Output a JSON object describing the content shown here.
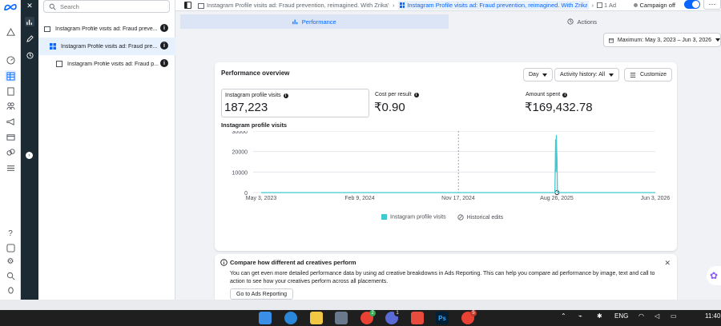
{
  "search": {
    "placeholder": "Search"
  },
  "tree": {
    "items": [
      {
        "label": "Instagram Profile visits ad: Fraud preve...",
        "type": "campaign"
      },
      {
        "label": "Instagram Profile visits ad: Fraud pre...",
        "type": "adset",
        "selected": true
      },
      {
        "label": "Instagram Profile visits ad: Fraud p...",
        "type": "ad"
      }
    ]
  },
  "breadcrumb": {
    "campaign": "Instagram Profile visits ad: Fraud prevention, reimagined. With Zrika's",
    "adset": "Instagram Profile visits ad: Fraud prevention, reimagined. With Zrika's",
    "ad": "1 Ad"
  },
  "status": {
    "campaign_state": "Campaign off"
  },
  "tabs": [
    {
      "label": "Performance",
      "active": true
    },
    {
      "label": "Actions",
      "active": false
    }
  ],
  "date_range": "Maximum: May 3, 2023 – Jun 3, 2026",
  "performance": {
    "title": "Performance overview",
    "controls": {
      "granularity": "Day",
      "activity": "Activity history: All",
      "customize": "Customize"
    },
    "metrics": [
      {
        "label": "Instagram profile visits",
        "value": "187,223"
      },
      {
        "label": "Cost per result",
        "value": "₹0.90"
      },
      {
        "label": "Amount spent",
        "value": "₹169,432.78"
      }
    ],
    "chart_title": "Instagram profile visits"
  },
  "chart_data": {
    "type": "line",
    "title": "Instagram profile visits",
    "x_ticks": [
      "May 3, 2023",
      "Feb 9, 2024",
      "Nov 17, 2024",
      "Aug 26, 2025",
      "Jun 3, 2026"
    ],
    "y_ticks": [
      "0",
      "10000",
      "20000",
      "30000"
    ],
    "ylim": [
      0,
      30000
    ],
    "xlim": [
      "2023-05-03",
      "2026-06-03"
    ],
    "series": [
      {
        "name": "Instagram profile visits",
        "color": "#3ecbcf",
        "points": [
          {
            "x": "2023-05-03",
            "y": 0
          },
          {
            "x": "2025-08-20",
            "y": 0
          },
          {
            "x": "2025-08-22",
            "y": 26000
          },
          {
            "x": "2025-08-23",
            "y": 10000
          },
          {
            "x": "2025-08-24",
            "y": 28000
          },
          {
            "x": "2025-08-25",
            "y": 20000
          },
          {
            "x": "2025-08-26",
            "y": 16000
          },
          {
            "x": "2025-08-27",
            "y": 0
          },
          {
            "x": "2026-06-03",
            "y": 0
          }
        ]
      }
    ],
    "markers": [
      {
        "x": "2024-11-17",
        "style": "dashed"
      },
      {
        "x": "2025-08-26",
        "label": "historical-edit"
      }
    ],
    "legend": [
      "Instagram profile visits",
      "Historical edits"
    ],
    "grid": true
  },
  "notice": {
    "title": "Compare how different ad creatives perform",
    "body": "You can get even more detailed performance data by using ad creative breakdowns in Ads Reporting. This can help you compare ad performance by image, text and call to action to see how your creatives perform across all placements.",
    "button": "Go to Ads Reporting"
  },
  "taskbar": {
    "language": "ENG",
    "time": "11:40",
    "badges": [
      "2",
      "1",
      "5"
    ]
  },
  "colors": {
    "accent": "#0866ff",
    "series": "#3ecbcf",
    "dark_panel": "#1c2b33"
  }
}
